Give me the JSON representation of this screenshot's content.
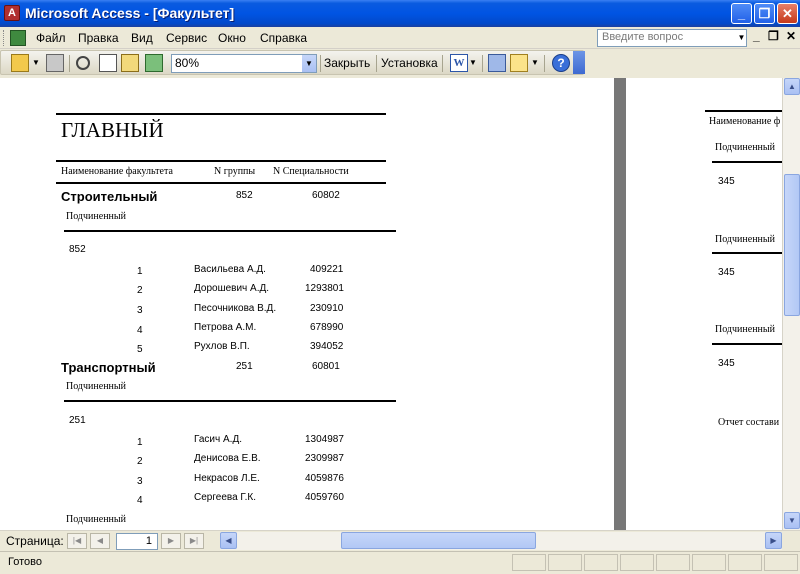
{
  "window": {
    "title": "Microsoft Access - [Факультет]"
  },
  "menu": {
    "items": [
      "Файл",
      "Правка",
      "Вид",
      "Сервис",
      "Окно",
      "Справка"
    ],
    "help_placeholder": "Введите вопрос"
  },
  "toolbar": {
    "zoom": "80%",
    "close_label": "Закрыть",
    "setup_label": "Установка",
    "word_label": "W",
    "help_label": "?"
  },
  "report": {
    "title": "ГЛАВНЫЙ",
    "headers": {
      "faculty": "Наименование факультета",
      "group": "N группы",
      "specialty": "N Специальности"
    },
    "faculties": [
      {
        "name": "Строительный",
        "group": "852",
        "specialty": "60802",
        "subreport_label": "Подчиненный",
        "group_again": "852",
        "students": [
          {
            "n": "1",
            "name": "Васильева А.Д.",
            "id": "409221"
          },
          {
            "n": "2",
            "name": "Дорошевич А.Д.",
            "id": "1293801"
          },
          {
            "n": "3",
            "name": "Песочникова В.Д.",
            "id": "230910"
          },
          {
            "n": "4",
            "name": "Петрова А.М.",
            "id": "678990"
          },
          {
            "n": "5",
            "name": "Рухлов В.П.",
            "id": "394052"
          }
        ]
      },
      {
        "name": "Транспортный",
        "group": "251",
        "specialty": "60801",
        "subreport_label": "Подчиненный",
        "group_again": "251",
        "students": [
          {
            "n": "1",
            "name": "Гасич А.Д.",
            "id": "1304987"
          },
          {
            "n": "2",
            "name": "Денисова Е.В.",
            "id": "2309987"
          },
          {
            "n": "3",
            "name": "Некрасов Л.Е.",
            "id": "4059876"
          },
          {
            "n": "4",
            "name": "Сергеева Г.К.",
            "id": "4059760"
          }
        ]
      }
    ],
    "trailing_label": "Подчиненный"
  },
  "page2": {
    "header": "Наименование ф",
    "blocks": [
      {
        "label": "Подчиненный",
        "value": "345"
      },
      {
        "label": "Подчиненный",
        "value": "345"
      },
      {
        "label": "Подчиненный",
        "value": "345"
      }
    ],
    "footer": "Отчет состави"
  },
  "nav": {
    "label": "Страница:",
    "page": "1"
  },
  "status": {
    "text": "Готово"
  }
}
